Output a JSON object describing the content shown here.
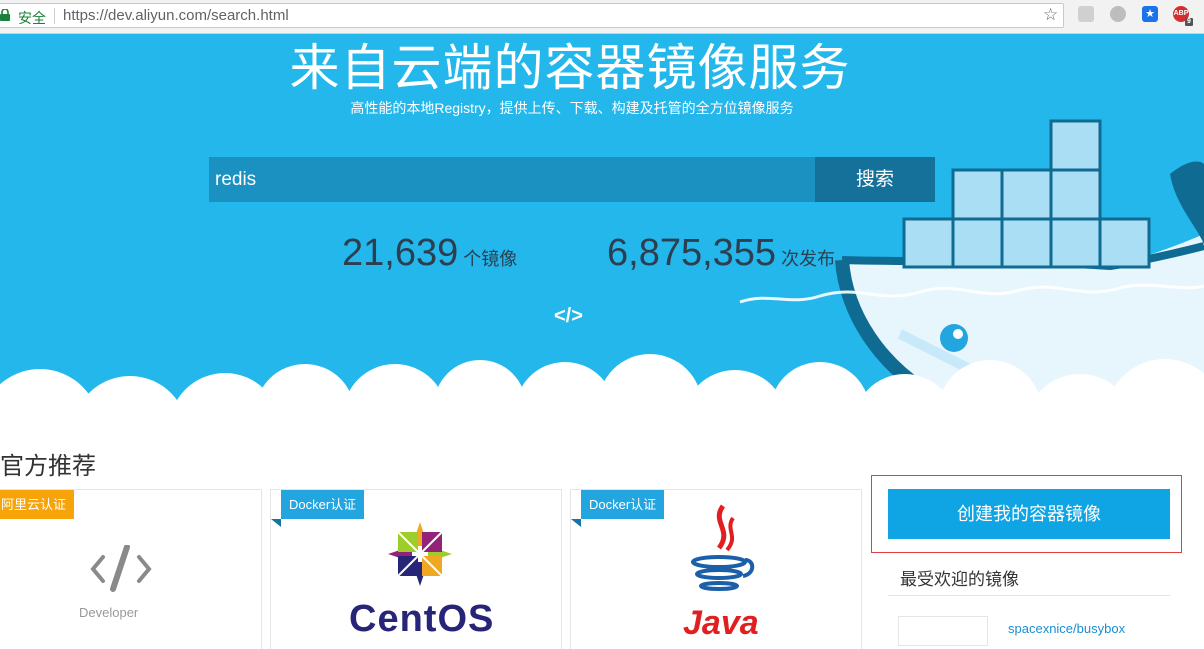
{
  "browser": {
    "secure_label": "安全",
    "url": "https://dev.aliyun.com/search.html",
    "ext_badge": "ABP",
    "ext_count": "9"
  },
  "hero": {
    "title": "来自云端的容器镜像服务",
    "subtitle": "高性能的本地Registry，提供上传、下载、构建及托管的全方位镜像服务",
    "search": {
      "value": "redis",
      "button": "搜索"
    },
    "stats": [
      {
        "number": "21,639",
        "label": "个镜像"
      },
      {
        "number": "6,875,355",
        "label": "次发布"
      }
    ],
    "code_glyph": "</>"
  },
  "recommend": {
    "title": "官方推荐",
    "cards": [
      {
        "tag": "阿里云认证",
        "caption": "Developer"
      },
      {
        "tag": "Docker认证",
        "brand": "CentOS"
      },
      {
        "tag": "Docker认证",
        "brand": "Java"
      }
    ]
  },
  "sidebar": {
    "create_button": "创建我的容器镜像",
    "popular_title": "最受欢迎的镜像",
    "popular_items": [
      {
        "name": "spacexnice/busybox"
      }
    ]
  },
  "colors": {
    "hero_bg": "#23b7ec",
    "search_input": "#1a91c1",
    "search_button": "#15719a",
    "tag_aliyun": "#f7a30a",
    "tag_docker": "#23a5e0",
    "create_button": "#0fa4e4",
    "highlight_border": "#e04040"
  }
}
